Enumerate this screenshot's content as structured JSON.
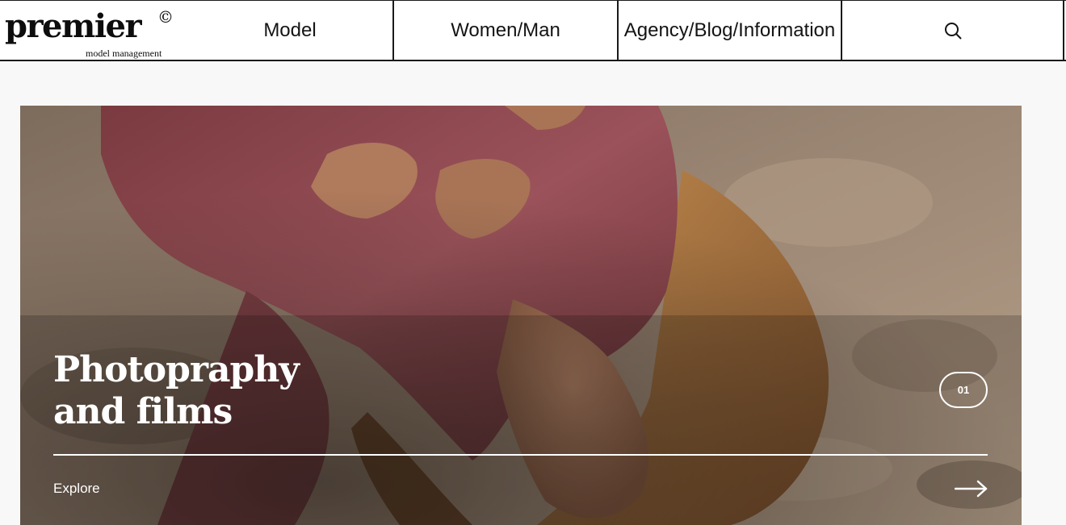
{
  "header": {
    "logo": {
      "wordmark": "premier",
      "copyright_mark": "©",
      "subtitle": "model management"
    },
    "nav": [
      {
        "label": "Model"
      },
      {
        "label": "Women/Man"
      },
      {
        "label": "Agency/Blog/Information"
      }
    ],
    "search_icon": "search-icon"
  },
  "hero": {
    "image_description_icon": "photo",
    "title_line1": "Photopraphy",
    "title_line2": "and films",
    "slide_number": "01",
    "cta_label": "Explore",
    "cta_icon": "arrow-right-icon"
  },
  "colors": {
    "background": "#f8f8f8",
    "header_border": "#1a1a1a",
    "hero_text": "#ffffff",
    "dress": "#8e4a50",
    "sand": "#9c8672"
  }
}
